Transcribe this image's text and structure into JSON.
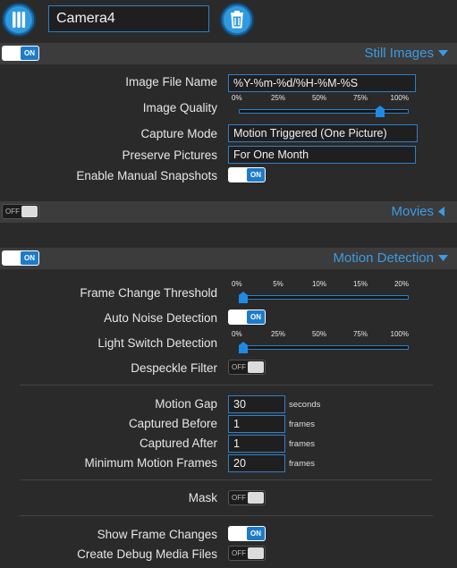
{
  "header": {
    "camera_name": "Camera4",
    "menu_icon": "columns-menu-icon",
    "delete_icon": "trash-icon"
  },
  "still_images": {
    "toggle": "ON",
    "title": "Still Images",
    "file_name_label": "Image File Name",
    "file_name_value": "%Y-%m-%d/%H-%M-%S",
    "quality_label": "Image Quality",
    "quality_ticks": [
      "0%",
      "25%",
      "50%",
      "75%",
      "100%"
    ],
    "quality_value": 0.85,
    "capture_mode_label": "Capture Mode",
    "capture_mode_value": "Motion Triggered (One Picture)",
    "preserve_label": "Preserve Pictures",
    "preserve_value": "For One Month",
    "manual_snapshots_label": "Enable Manual Snapshots",
    "manual_snapshots_toggle": "ON"
  },
  "movies": {
    "toggle": "OFF",
    "title": "Movies"
  },
  "motion_detection": {
    "toggle": "ON",
    "title": "Motion Detection",
    "frame_change_label": "Frame Change Threshold",
    "frame_change_ticks": [
      "0%",
      "5%",
      "10%",
      "15%",
      "20%"
    ],
    "frame_change_value": 0.0,
    "auto_noise_label": "Auto Noise Detection",
    "auto_noise_toggle": "ON",
    "light_switch_label": "Light Switch Detection",
    "light_switch_ticks": [
      "0%",
      "25%",
      "50%",
      "75%",
      "100%"
    ],
    "light_switch_value": 0.0,
    "despeckle_label": "Despeckle Filter",
    "despeckle_toggle": "OFF",
    "motion_gap_label": "Motion Gap",
    "motion_gap_value": "30",
    "motion_gap_unit": "seconds",
    "captured_before_label": "Captured Before",
    "captured_before_value": "1",
    "captured_before_unit": "frames",
    "captured_after_label": "Captured After",
    "captured_after_value": "1",
    "captured_after_unit": "frames",
    "min_frames_label": "Minimum Motion Frames",
    "min_frames_value": "20",
    "min_frames_unit": "frames",
    "mask_label": "Mask",
    "mask_toggle": "OFF",
    "show_changes_label": "Show Frame Changes",
    "show_changes_toggle": "ON",
    "debug_media_label": "Create Debug Media Files",
    "debug_media_toggle": "OFF"
  },
  "colors": {
    "accent": "#3a9be6",
    "background": "#2a2a2a",
    "section_bar": "#3c3c3c"
  }
}
